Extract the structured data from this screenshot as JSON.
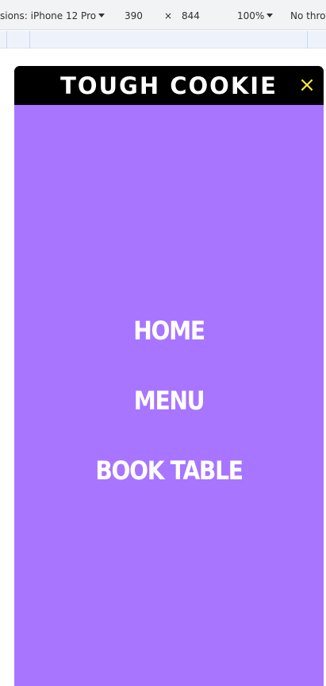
{
  "devtools": {
    "device_label": "sions: iPhone 12 Pro",
    "width": "390",
    "times": "×",
    "height": "844",
    "zoom": "100%",
    "throttle": "No thro"
  },
  "app": {
    "brand": "TOUGH COOKIE",
    "close_icon": "×",
    "nav": [
      "HOME",
      "MENU",
      "BOOK TABLE"
    ]
  },
  "colors": {
    "menu_background": "#a775ff",
    "header_background": "#000000",
    "close_icon": "#f7e83a"
  }
}
